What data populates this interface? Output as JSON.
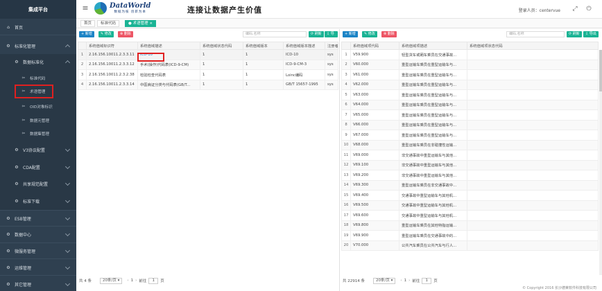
{
  "app": {
    "title": "集成平台"
  },
  "sidebar": {
    "home": "首页",
    "std": "标准化管理",
    "data_std": "数据标准化",
    "std_code": "标准代码",
    "term_mgmt": "术语管理",
    "oid": "OID对象标识",
    "data_element": "数据元管理",
    "dataset": "数据集管理",
    "v3": "V3协议配置",
    "cda": "CDA配置",
    "share": "共享规范配置",
    "download": "标准下载",
    "esb": "ESB管理",
    "data_center": "数据中心",
    "micro": "微服务管理",
    "ops": "运维管理",
    "other": "其它管理"
  },
  "header": {
    "logo_title": "DataWorld",
    "logo_sub": "数据为核 创新为本",
    "slogan": "连接让数据产生价值",
    "user_label": "登录人员：centervue"
  },
  "tabs": [
    {
      "label": "首页"
    },
    {
      "label": "标准代码"
    },
    {
      "label": "术语管理"
    }
  ],
  "left": {
    "toolbar": {
      "add": "+ 新增",
      "edit": "✎ 修改",
      "del": "⊗ 删除",
      "search_ph": "编码,名称",
      "refresh": "⟳ 刷新",
      "export": "⇩ 导出"
    },
    "columns": [
      "",
      "系统值域标识符",
      "系统值域描述",
      "系统值域状态代码",
      "系统值域版本",
      "系统值域版本描述",
      "注册者"
    ],
    "rows": [
      [
        "1",
        "2.16.156.10011.2.3.3.11",
        "ICD-10",
        "1",
        "1",
        "ICD-10",
        "sys"
      ],
      [
        "2",
        "2.16.156.10011.2.3.3.12",
        "手术(操作)代码表(ICD-9-CM)",
        "1",
        "1",
        "ICD-9-CM-3",
        "sys"
      ],
      [
        "3",
        "2.16.156.10011.2.3.2.38",
        "检验检查代码表",
        "1",
        "1",
        "Loinc编码",
        "sys"
      ],
      [
        "4",
        "2.16.156.10011.2.3.3.14",
        "中医病证分类与代码表(GB/T...",
        "1",
        "1",
        "GB/T 15657-1995",
        "sys"
      ]
    ],
    "pager": {
      "total": "共 4 条",
      "size": "20条/页",
      "prefix": "前往",
      "page": "1",
      "suffix": "页"
    }
  },
  "right": {
    "toolbar": {
      "add": "+ 新增",
      "edit": "✎ 修改",
      "del": "⊗ 删除",
      "search_ph": "编码,名称",
      "refresh": "⟳ 刷新",
      "export": "⇩ 导出"
    },
    "columns": [
      "",
      "系统值域项代码",
      "系统值域项描述",
      "系统值域项状态代码"
    ],
    "rows": [
      [
        "1",
        "V59.900",
        "轻型货车或厢车乘员在交通事故..."
      ],
      [
        "2",
        "V60.000",
        "重型运输车乘员在重型运输车与..."
      ],
      [
        "3",
        "V61.000",
        "重型运输车乘员在重型运输车与..."
      ],
      [
        "4",
        "V62.000",
        "重型运输车乘员在重型运输车与..."
      ],
      [
        "5",
        "V63.000",
        "重型运输车乘员在重型运输车与..."
      ],
      [
        "6",
        "V64.000",
        "重型运输车乘员在重型运输车与..."
      ],
      [
        "7",
        "V65.000",
        "重型运输车乘员在重型运输车与..."
      ],
      [
        "8",
        "V66.000",
        "重型运输车乘员在重型运输车与..."
      ],
      [
        "9",
        "V67.000",
        "重型运输车乘员在重型运输车与..."
      ],
      [
        "10",
        "V68.000",
        "重型运输车乘员在非碰撞性运输..."
      ],
      [
        "11",
        "V69.000",
        "非交通事故中重型运输车与其他..."
      ],
      [
        "12",
        "V69.100",
        "非交通事故中重型运输车与其他..."
      ],
      [
        "13",
        "V69.200",
        "非交通事故中重型运输车与其他..."
      ],
      [
        "14",
        "V69.300",
        "重型运输车乘员在非交通事故中..."
      ],
      [
        "15",
        "V69.400",
        "交通事故中重型运输车与其他机..."
      ],
      [
        "16",
        "V69.500",
        "交通事故中重型运输车与其他机..."
      ],
      [
        "17",
        "V69.600",
        "交通事故中重型运输车与其他机..."
      ],
      [
        "18",
        "V69.800",
        "重型运输车乘员在其他特指运输..."
      ],
      [
        "19",
        "V69.900",
        "重型运输车乘员在交通事故中的..."
      ],
      [
        "20",
        "V70.000",
        "公共汽车乘员在公共汽车与行人..."
      ]
    ],
    "pager": {
      "total": "共 22914 条",
      "size": "20条/页",
      "prefix": "前往",
      "page": "1",
      "suffix": "页"
    }
  },
  "footer": "© Copyright 2016 长沙德莱软件科技有限公司"
}
